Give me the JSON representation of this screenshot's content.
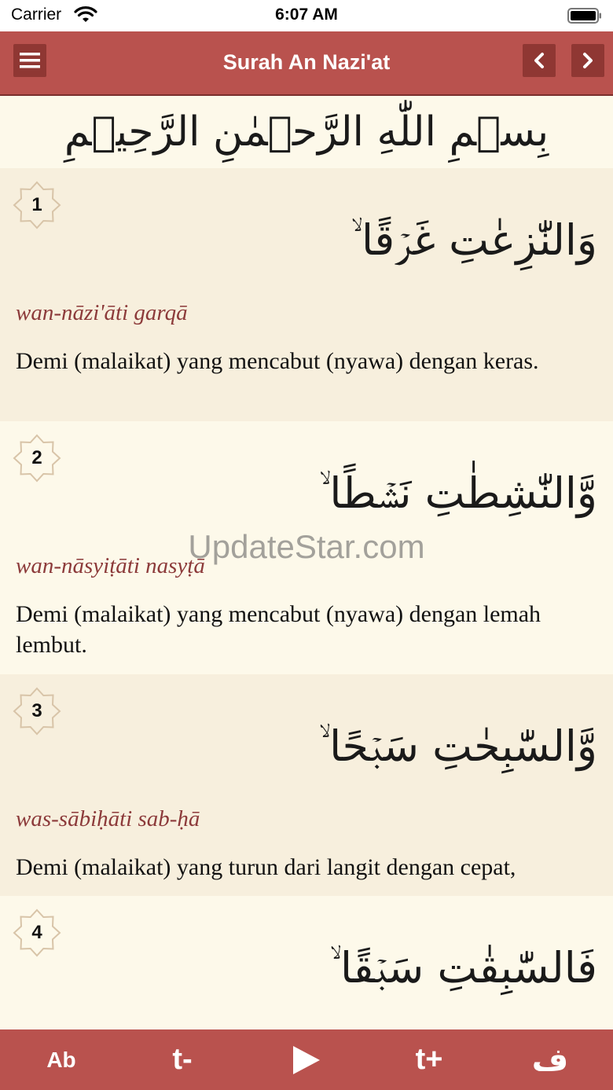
{
  "status_bar": {
    "carrier": "Carrier",
    "time": "6:07 AM"
  },
  "nav": {
    "title": "Surah An Nazi'at"
  },
  "bismillah": "بِسۡمِ اللّٰهِ الرَّحۡمٰنِ الرَّحِيۡمِ",
  "ayahs": [
    {
      "number": "1",
      "arabic": "وَالنّٰزِعٰتِ غَرۡقًا ۙ",
      "transliteration": "wan-nāzi'āti garqā",
      "translation": "Demi (malaikat) yang mencabut (nyawa) dengan keras."
    },
    {
      "number": "2",
      "arabic": "وَّالنّٰشِطٰتِ نَشۡطًا ۙ",
      "transliteration": "wan-nāsyiṭāti nasyṭā",
      "translation": "Demi (malaikat) yang mencabut (nyawa) dengan lemah lembut."
    },
    {
      "number": "3",
      "arabic": "وَّالسّٰبِحٰتِ سَبۡحًا ۙ",
      "transliteration": "was-sābiḥāti sab-ḥā",
      "translation": "Demi (malaikat) yang turun dari langit dengan cepat,"
    },
    {
      "number": "4",
      "arabic": "فَالسّٰبِقٰتِ سَبۡقًا ۙ",
      "transliteration": "",
      "translation": ""
    }
  ],
  "watermark": "UpdateStar.com",
  "tab_bar": {
    "font_style": "Ab",
    "text_smaller": "t-",
    "text_larger": "t+",
    "arabic_toggle": "ف"
  },
  "colors": {
    "brand": "#b9524e",
    "brand_dark": "#8f3733",
    "transliteration": "#8c3a3a",
    "row_shade": "#f7efdd",
    "row_plain": "#fdf9ea"
  }
}
